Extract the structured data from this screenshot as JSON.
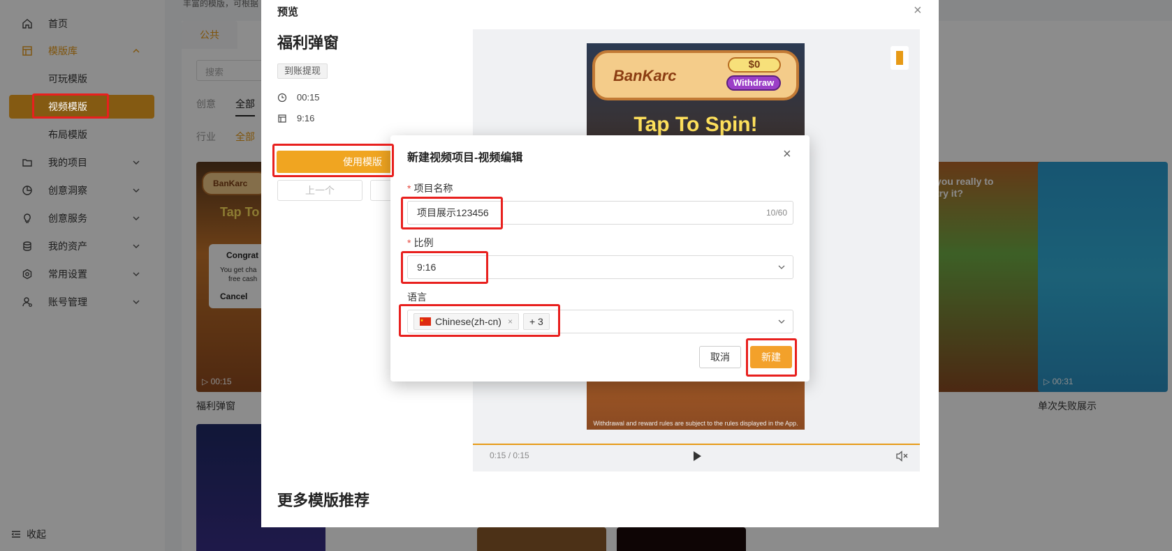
{
  "sidebar": {
    "home": "首页",
    "template_lib": "模版库",
    "sub_playable": "可玩模版",
    "sub_video": "视频模版",
    "sub_layout": "布局模版",
    "my_projects": "我的项目",
    "insight": "创意洞察",
    "service": "创意服务",
    "assets": "我的资产",
    "settings": "常用设置",
    "account": "账号管理",
    "collapse": "收起"
  },
  "background": {
    "top_note": "丰富的模版，可根据",
    "tab_public": "公共",
    "search_placeholder": "搜索",
    "filter_creative": "创意",
    "filter_all": "全部",
    "filter_industry": "行业",
    "filter_industry_all": "全部",
    "card1": {
      "title": "福利弹窗",
      "duration": "00:15",
      "popup_title": "Congrat",
      "popup_line1": "You get cha",
      "popup_line2": "free cash",
      "popup_cancel": "Cancel",
      "brand": "BanKarc",
      "headline": "Tap To"
    },
    "card2": {
      "title": "单次失败展示",
      "duration": "00:31"
    },
    "card3": {
      "headline": "you really to try it?"
    }
  },
  "preview": {
    "title": "预览",
    "name": "福利弹窗",
    "tag": "到账提现",
    "duration": "00:15",
    "ratio": "9:16",
    "use_button": "使用模版",
    "prev_button": "上一个",
    "more_title": "更多模版推荐",
    "player_time": "0:15 / 0:15",
    "video": {
      "brand": "BanKarc",
      "amount": "$0",
      "withdraw": "Withdraw",
      "headline": "Tap To Spin!",
      "fine_print": "Withdrawal and reward rules are subject to the rules displayed in the App."
    }
  },
  "modal": {
    "title": "新建视频项目-视频编辑",
    "name_label": "项目名称",
    "name_value": "项目展示123456",
    "name_count": "10/60",
    "ratio_label": "比例",
    "ratio_value": "9:16",
    "lang_label": "语言",
    "lang_tag": "Chinese(zh-cn)",
    "lang_more": "+ 3",
    "cancel": "取消",
    "create": "新建"
  },
  "colors": {
    "accent": "#f0a521",
    "annotation": "#e8201e"
  }
}
